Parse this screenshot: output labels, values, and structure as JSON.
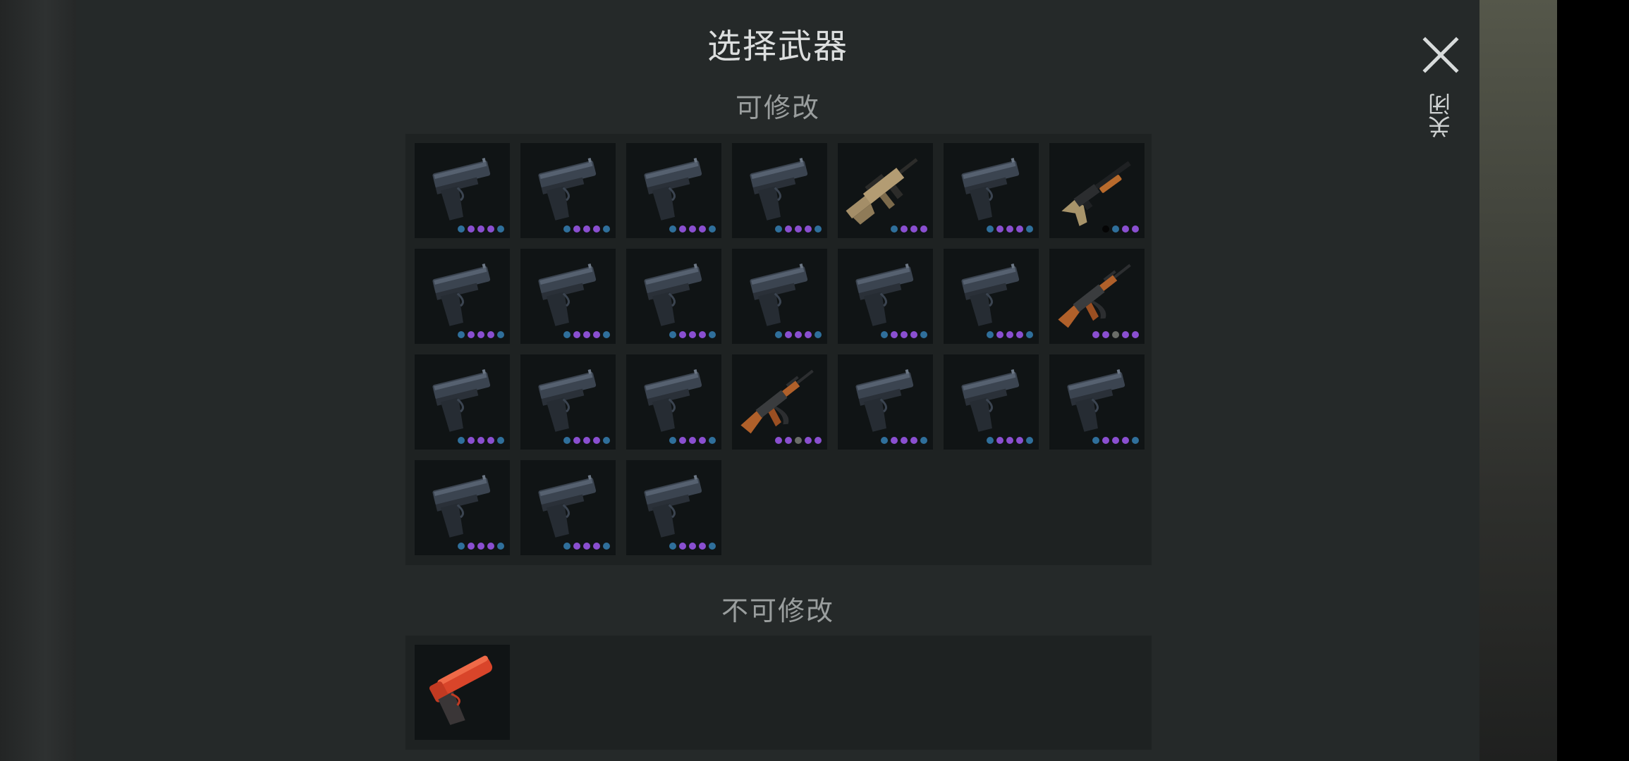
{
  "dialog": {
    "title": "选择武器",
    "close_label": "关闭"
  },
  "colors": {
    "blue": "#2f6f9b",
    "purple": "#8a4fd0",
    "gray": "#6a6d68",
    "black": "#050505"
  },
  "sections": [
    {
      "title": "可修改",
      "rows": [
        [
          {
            "weapon": "pistol-icon",
            "dots": [
              "blue",
              "purple",
              "purple",
              "purple",
              "blue"
            ]
          },
          {
            "weapon": "pistol-icon",
            "dots": [
              "blue",
              "purple",
              "purple",
              "purple",
              "blue"
            ]
          },
          {
            "weapon": "pistol-icon",
            "dots": [
              "blue",
              "purple",
              "purple",
              "purple",
              "blue"
            ]
          },
          {
            "weapon": "pistol-icon",
            "dots": [
              "blue",
              "purple",
              "purple",
              "purple",
              "blue"
            ]
          },
          {
            "weapon": "assault-rifle-scar-icon",
            "dots": [
              "blue",
              "purple",
              "purple",
              "purple"
            ]
          },
          {
            "weapon": "pistol-icon",
            "dots": [
              "blue",
              "purple",
              "purple",
              "purple",
              "blue"
            ]
          },
          {
            "weapon": "shotgun-icon",
            "dots": [
              "black",
              "blue",
              "purple",
              "purple"
            ]
          }
        ],
        [
          {
            "weapon": "pistol-icon",
            "dots": [
              "blue",
              "purple",
              "purple",
              "purple",
              "blue"
            ]
          },
          {
            "weapon": "pistol-icon",
            "dots": [
              "blue",
              "purple",
              "purple",
              "purple",
              "blue"
            ]
          },
          {
            "weapon": "pistol-icon",
            "dots": [
              "blue",
              "purple",
              "purple",
              "purple",
              "blue"
            ]
          },
          {
            "weapon": "pistol-icon",
            "dots": [
              "blue",
              "purple",
              "purple",
              "purple",
              "blue"
            ]
          },
          {
            "weapon": "pistol-icon",
            "dots": [
              "blue",
              "purple",
              "purple",
              "purple",
              "blue"
            ]
          },
          {
            "weapon": "pistol-icon",
            "dots": [
              "blue",
              "purple",
              "purple",
              "purple",
              "blue"
            ]
          },
          {
            "weapon": "ak47-icon",
            "dots": [
              "purple",
              "purple",
              "gray",
              "purple",
              "purple"
            ]
          }
        ],
        [
          {
            "weapon": "pistol-icon",
            "dots": [
              "blue",
              "purple",
              "purple",
              "purple",
              "blue"
            ]
          },
          {
            "weapon": "pistol-icon",
            "dots": [
              "blue",
              "purple",
              "purple",
              "purple",
              "blue"
            ]
          },
          {
            "weapon": "pistol-icon",
            "dots": [
              "blue",
              "purple",
              "purple",
              "purple",
              "blue"
            ]
          },
          {
            "weapon": "ak47-icon",
            "dots": [
              "purple",
              "purple",
              "gray",
              "purple",
              "purple"
            ]
          },
          {
            "weapon": "pistol-icon",
            "dots": [
              "blue",
              "purple",
              "purple",
              "purple",
              "blue"
            ]
          },
          {
            "weapon": "pistol-icon",
            "dots": [
              "blue",
              "purple",
              "purple",
              "purple",
              "blue"
            ]
          },
          {
            "weapon": "pistol-icon",
            "dots": [
              "blue",
              "purple",
              "purple",
              "purple",
              "blue"
            ]
          }
        ],
        [
          {
            "weapon": "pistol-icon",
            "dots": [
              "blue",
              "purple",
              "purple",
              "purple",
              "blue"
            ]
          },
          {
            "weapon": "pistol-icon",
            "dots": [
              "blue",
              "purple",
              "purple",
              "purple",
              "blue"
            ]
          },
          {
            "weapon": "pistol-icon",
            "dots": [
              "blue",
              "purple",
              "purple",
              "purple",
              "blue"
            ]
          }
        ]
      ]
    },
    {
      "title": "不可修改",
      "rows": [
        [
          {
            "weapon": "flare-gun-icon",
            "dots": []
          }
        ]
      ]
    }
  ]
}
